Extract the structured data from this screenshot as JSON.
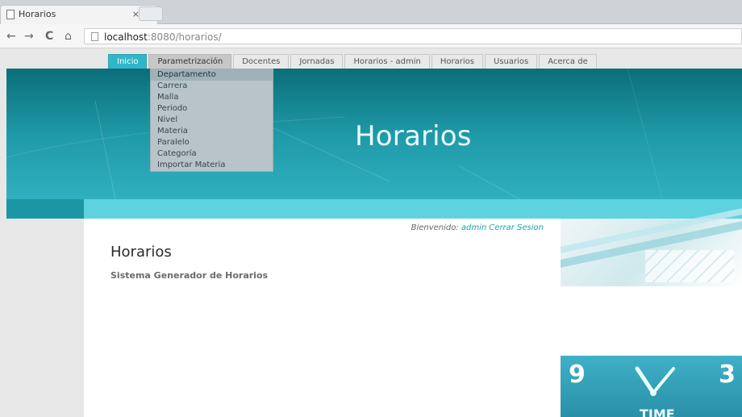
{
  "browser": {
    "tab_title": "Horarios",
    "tab_close": "×",
    "url_host": "localhost",
    "url_rest": ":8080/horarios/",
    "nav": {
      "back": "←",
      "forward": "→",
      "reload": "C",
      "home": "⌂"
    }
  },
  "menu": {
    "items": [
      {
        "label": "Inicio",
        "state": "active"
      },
      {
        "label": "Parametrización",
        "state": "open"
      },
      {
        "label": "Docentes",
        "state": ""
      },
      {
        "label": "Jornadas",
        "state": ""
      },
      {
        "label": "Horarios - admin",
        "state": ""
      },
      {
        "label": "Horarios",
        "state": ""
      },
      {
        "label": "Usuarios",
        "state": ""
      },
      {
        "label": "Acerca de",
        "state": ""
      }
    ],
    "dropdown": [
      "Departamento",
      "Carrera",
      "Malla",
      "Periodo",
      "Nivel",
      "Materia",
      "Paralelo",
      "Categoría",
      "Importar Materia"
    ]
  },
  "hero": {
    "title": "Horarios"
  },
  "content": {
    "welcome_prefix": "Bienvenido: ",
    "welcome_user": "admin",
    "logout": "Cerrar Sesion",
    "heading": "Horarios",
    "subheading": "Sistema Generador de Horarios"
  },
  "side_images": {
    "clock": {
      "n9": "9",
      "n3": "3",
      "time_text": "TIME"
    }
  }
}
